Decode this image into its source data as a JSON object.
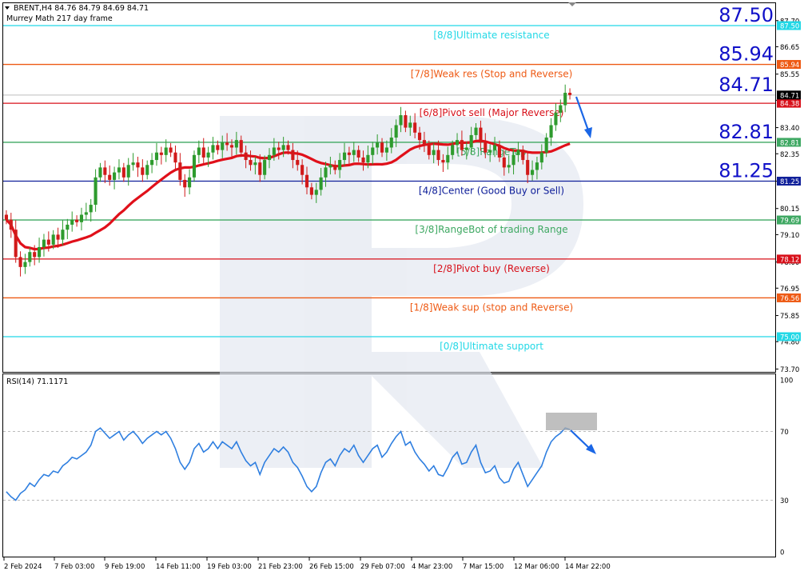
{
  "header": {
    "symbol_line": "BRENT,H4  84.76 84.79 84.69 84.71",
    "indicator_name": "Murrey Math 217 day frame"
  },
  "colors": {
    "bull": "#2e9b2e",
    "bear": "#d11a1a",
    "ma": "#e0101a",
    "rsi": "#2f7fe0",
    "arrow": "#1a66e6",
    "big_label": "#1010c8"
  },
  "rsi_panel": {
    "title": "RSI(14) 71.1171",
    "axis_labels": [
      "100",
      "70",
      "30",
      "0"
    ]
  },
  "x_axis_labels": [
    "2 Feb 2024",
    "7 Feb 03:00",
    "9 Feb 19:00",
    "14 Feb 11:00",
    "19 Feb 03:00",
    "21 Feb 23:00",
    "26 Feb 15:00",
    "29 Feb 07:00",
    "4 Mar 23:00",
    "7 Mar 15:00",
    "12 Mar 06:00",
    "14 Mar 22:00"
  ],
  "price_axis_labels": [
    "87.70",
    "86.65",
    "85.55",
    "84.50",
    "83.40",
    "82.35",
    "81.25",
    "80.15",
    "79.10",
    "78.00",
    "76.95",
    "75.85",
    "74.80",
    "73.70"
  ],
  "big_levels": [
    "87.50",
    "85.94",
    "84.71",
    "82.81",
    "81.25"
  ],
  "murrey_lines": [
    {
      "price": 87.5,
      "label": "[8/8]Ultimate resistance",
      "color": "#22d8e6",
      "tag": "87.50",
      "tag_text": "#ffffff"
    },
    {
      "price": 85.94,
      "label": "[7/8]Weak res (Stop and Reverse)",
      "color": "#ee5a14",
      "tag": "85.94",
      "tag_text": "#ffffff"
    },
    {
      "price": 84.38,
      "label": "[6/8]Pivot sell (Major Reverse)",
      "color": "#d8101a",
      "tag": "84.38",
      "tag_text": "#ffffff"
    },
    {
      "price": 82.81,
      "label": "[5/8]RangeTop",
      "color": "#3ea862",
      "tag": "82.81",
      "tag_text": "#ffffff"
    },
    {
      "price": 81.25,
      "label": "[4/8]Center (Good Buy or Sell)",
      "color": "#10209a",
      "tag": "81.25",
      "tag_text": "#ffffff"
    },
    {
      "price": 79.69,
      "label": "[3/8]RangeBot of trading Range",
      "color": "#3ea862",
      "tag": "79.69",
      "tag_text": "#ffffff"
    },
    {
      "price": 78.12,
      "label": "[2/8]Pivot buy (Reverse)",
      "color": "#d8101a",
      "tag": "78.12",
      "tag_text": "#ffffff"
    },
    {
      "price": 76.56,
      "label": "[1/8]Weak sup (stop and Reverse)",
      "color": "#ee5a14",
      "tag": "76.56",
      "tag_text": "#ffffff"
    },
    {
      "price": 75.0,
      "label": "[0/8]Ultimate support",
      "color": "#22d8e6",
      "tag": "75.00",
      "tag_text": "#ffffff"
    }
  ],
  "current_price": {
    "value": "84.71",
    "color": "#000000"
  },
  "chart_data": {
    "type": "candlestick",
    "price_range": [
      73.5,
      88.3
    ],
    "rsi_range": [
      0,
      100
    ],
    "rsi_levels": [
      70,
      30
    ],
    "closes": [
      79.7,
      79.3,
      78.2,
      77.8,
      78.0,
      78.4,
      78.2,
      78.6,
      78.9,
      78.7,
      79.1,
      78.9,
      79.3,
      79.5,
      79.7,
      79.6,
      79.9,
      80.0,
      80.3,
      81.4,
      81.8,
      81.5,
      81.3,
      81.6,
      81.8,
      81.4,
      81.9,
      82.0,
      81.8,
      81.5,
      81.9,
      82.1,
      82.4,
      82.3,
      82.6,
      82.4,
      82.0,
      81.3,
      81.0,
      81.4,
      82.3,
      82.6,
      82.2,
      82.4,
      82.7,
      82.5,
      82.8,
      82.7,
      82.6,
      82.9,
      82.4,
      82.1,
      81.9,
      82.0,
      81.5,
      82.1,
      82.3,
      82.6,
      82.5,
      82.7,
      82.5,
      82.1,
      81.9,
      81.5,
      81.0,
      80.7,
      80.9,
      81.4,
      81.8,
      81.9,
      81.7,
      82.1,
      82.4,
      82.3,
      82.5,
      82.2,
      82.0,
      82.3,
      82.6,
      82.8,
      82.4,
      82.6,
      83.0,
      83.5,
      83.9,
      83.4,
      83.6,
      83.2,
      82.9,
      82.7,
      82.3,
      82.5,
      82.1,
      82.0,
      82.3,
      82.7,
      82.9,
      82.5,
      82.6,
      83.1,
      83.4,
      82.8,
      82.4,
      82.5,
      82.7,
      82.2,
      81.8,
      81.9,
      82.3,
      82.5,
      82.1,
      81.5,
      81.7,
      82.0,
      82.4,
      83.0,
      83.5,
      84.0,
      84.3,
      84.8,
      84.71
    ],
    "rsi": [
      35,
      32,
      30,
      34,
      36,
      40,
      38,
      42,
      45,
      44,
      47,
      46,
      50,
      52,
      55,
      54,
      56,
      58,
      62,
      70,
      72,
      69,
      66,
      68,
      70,
      65,
      68,
      70,
      67,
      63,
      66,
      68,
      70,
      68,
      70,
      66,
      60,
      52,
      48,
      52,
      60,
      63,
      58,
      60,
      64,
      60,
      64,
      62,
      60,
      64,
      58,
      53,
      50,
      52,
      45,
      52,
      56,
      60,
      58,
      61,
      58,
      52,
      49,
      44,
      38,
      35,
      38,
      46,
      52,
      54,
      50,
      56,
      60,
      58,
      62,
      56,
      52,
      56,
      60,
      62,
      55,
      58,
      63,
      67,
      70,
      62,
      64,
      58,
      54,
      51,
      47,
      50,
      45,
      44,
      49,
      55,
      58,
      51,
      52,
      58,
      62,
      52,
      46,
      47,
      50,
      43,
      40,
      41,
      48,
      52,
      45,
      38,
      42,
      46,
      50,
      58,
      64,
      67,
      69,
      72,
      71.1
    ]
  }
}
